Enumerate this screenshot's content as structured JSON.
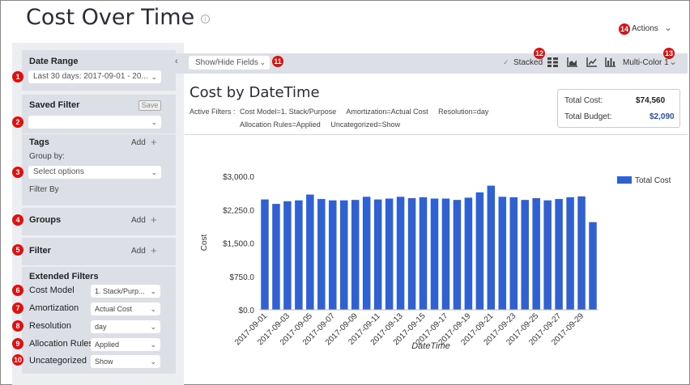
{
  "header": {
    "title": "Cost Over Time",
    "actions_label": "Actions"
  },
  "badges": [
    "1",
    "2",
    "3",
    "4",
    "5",
    "6",
    "7",
    "8",
    "9",
    "10",
    "11",
    "12",
    "13",
    "14"
  ],
  "sidebar": {
    "date_range": {
      "title": "Date Range",
      "value": "Last 30 days:  2017-09-01 - 20..."
    },
    "saved_filter": {
      "title": "Saved Filter",
      "save_label": "Save",
      "value": ""
    },
    "tags": {
      "title": "Tags",
      "add_label": "Add",
      "group_by_label": "Group by:",
      "placeholder": "Select options",
      "filter_by_label": "Filter By"
    },
    "groups": {
      "title": "Groups",
      "add_label": "Add"
    },
    "filter": {
      "title": "Filter",
      "add_label": "Add"
    },
    "extended_filters": {
      "title": "Extended Filters",
      "items": [
        {
          "label": "Cost Model",
          "value": "1. Stack/Purp..."
        },
        {
          "label": "Amortization",
          "value": "Actual Cost"
        },
        {
          "label": "Resolution",
          "value": "day"
        },
        {
          "label": "Allocation Rules",
          "value": "Applied"
        },
        {
          "label": "Uncategorized",
          "value": "Show"
        }
      ]
    }
  },
  "toolbar": {
    "show_hide_label": "Show/Hide Fields",
    "stacked_label": "Stacked",
    "palette_label": "Multi-Color 1"
  },
  "main": {
    "title": "Cost by DateTime",
    "active_filters_label": "Active Filters :",
    "active_filters_line1": "Cost Model=1. Stack/Purpose     Amortization=Actual Cost     Resolution=day",
    "active_filters_line2": "Allocation Rules=Applied     Uncategorized=Show",
    "total_cost_label": "Total Cost:",
    "total_cost_value": "$74,560",
    "total_budget_label": "Total Budget:",
    "total_budget_value": "$2,090"
  },
  "colors": {
    "bar": "#3161d1",
    "budget": "#2a4fa8",
    "badge": "#e01010"
  },
  "chart_data": {
    "type": "bar",
    "xlabel": "DateTime",
    "ylabel": "Cost",
    "ylim": [
      0,
      3000
    ],
    "yticks": [
      "$0.0",
      "$750.0",
      "$1,500.0",
      "$2,250.0",
      "$3,000.0"
    ],
    "legend": "Total Cost",
    "categories": [
      "2017-09-01",
      "2017-09-02",
      "2017-09-03",
      "2017-09-04",
      "2017-09-05",
      "2017-09-06",
      "2017-09-07",
      "2017-09-08",
      "2017-09-09",
      "2017-09-10",
      "2017-09-11",
      "2017-09-12",
      "2017-09-13",
      "2017-09-14",
      "2017-09-15",
      "2017-09-16",
      "2017-09-17",
      "2017-09-18",
      "2017-09-19",
      "2017-09-20",
      "2017-09-21",
      "2017-09-22",
      "2017-09-23",
      "2017-09-24",
      "2017-09-25",
      "2017-09-26",
      "2017-09-27",
      "2017-09-28",
      "2017-09-29",
      "2017-09-30"
    ],
    "tick_labels": [
      "2017-09-01",
      "2017-09-03",
      "2017-09-05",
      "2017-09-07",
      "2017-09-09",
      "2017-09-11",
      "2017-09-13",
      "2017-09-15",
      "2017-09-17",
      "2017-09-19",
      "2017-09-21",
      "2017-09-23",
      "2017-09-25",
      "2017-09-27",
      "2017-09-29"
    ],
    "series": [
      {
        "name": "Total Cost",
        "values": [
          2480,
          2380,
          2440,
          2460,
          2590,
          2490,
          2460,
          2460,
          2470,
          2540,
          2480,
          2500,
          2540,
          2510,
          2530,
          2500,
          2500,
          2470,
          2520,
          2640,
          2790,
          2540,
          2530,
          2470,
          2510,
          2460,
          2490,
          2530,
          2550,
          1970
        ]
      }
    ]
  }
}
